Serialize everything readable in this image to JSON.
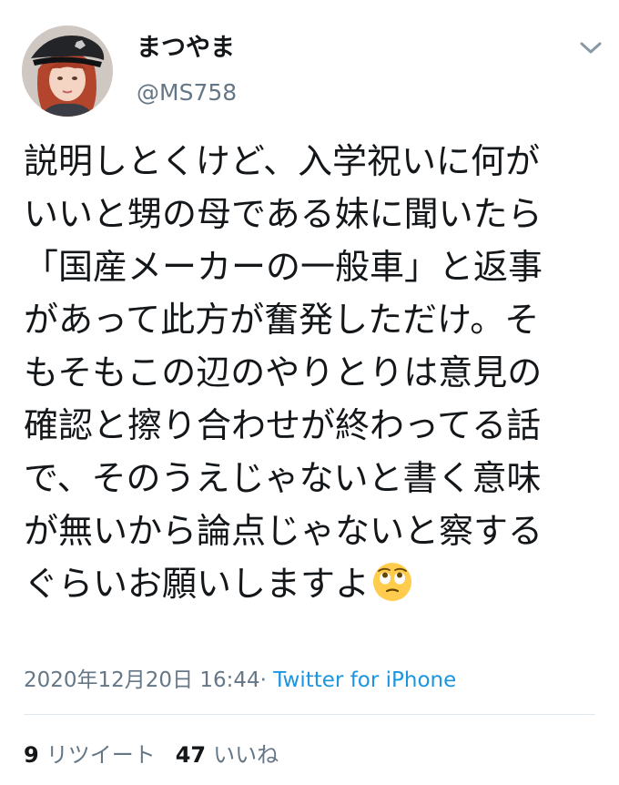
{
  "user": {
    "display_name": "まつやま",
    "handle": "@MS758",
    "avatar_icon": "profile-photo-police-hat"
  },
  "menu": {
    "icon": "chevron-down-icon"
  },
  "tweet": {
    "lines": [
      "説明しとくけど、入学祝いに何が",
      "いいと甥の母である妹に聞いたら",
      "「国産メーカーの一般車」と返事",
      "があって此方が奮発しただけ。そ",
      "もそもこの辺のやりとりは意見の",
      "確認と擦り合わせが終わってる話",
      "で、そのうえじゃないと書く意味",
      "が無いから論点じゃないと察する",
      "ぐらいお願いしますよ"
    ],
    "emoji": "face-with-rolling-eyes"
  },
  "meta": {
    "timestamp": "2020年12月20日 16:44",
    "separator": "·",
    "source": "Twitter for iPhone"
  },
  "stats": {
    "retweets_count": "9",
    "retweets_label": "リツイート",
    "likes_count": "47",
    "likes_label": "いいね"
  },
  "colors": {
    "text": "#14171a",
    "secondary": "#657786",
    "link": "#1b95e0",
    "divider": "#e1e8ed"
  }
}
